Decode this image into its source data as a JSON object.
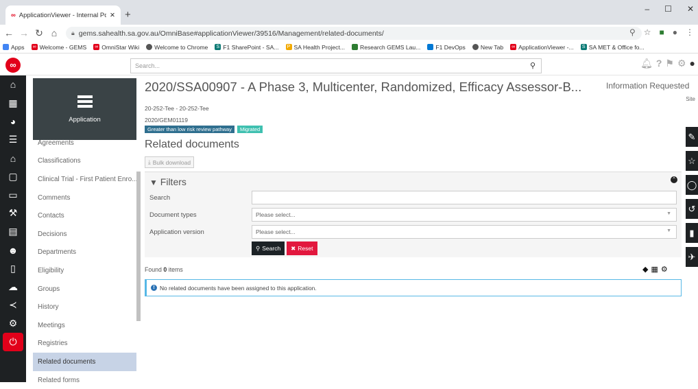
{
  "browser": {
    "tab_title": "ApplicationViewer - Internal Port",
    "url": "gems.sahealth.sa.gov.au/OmniBase#applicationViewer/39516/Management/related-documents/",
    "bookmarks": [
      "Apps",
      "Welcome - GEMS",
      "OmniStar Wiki",
      "Welcome to Chrome",
      "F1 SharePoint - SA...",
      "SA Health Project...",
      "Research GEMS Lau...",
      "F1 DevOps",
      "New Tab",
      "ApplicationViewer -...",
      "SA MET & Office fo..."
    ]
  },
  "topbar": {
    "search_placeholder": "Search..."
  },
  "sidebar": {
    "app_label": "Application",
    "items": [
      "Agreements",
      "Classifications",
      "Clinical Trial - First Patient Enro...",
      "Comments",
      "Contacts",
      "Decisions",
      "Departments",
      "Eligibility",
      "Groups",
      "History",
      "Meetings",
      "Registries",
      "Related documents",
      "Related forms"
    ]
  },
  "app": {
    "title": "2020/SSA00907 - A Phase 3, Multicenter, Randomized, Efficacy Assessor-B...",
    "status": "Information Requested",
    "site": "Site",
    "sub1": "20-252-Tee - 20-252-Tee",
    "sub2": "2020/GEM01119",
    "badges": [
      "Greater than low risk review pathway",
      "Migrated"
    ]
  },
  "section": {
    "title": "Related documents",
    "bulk_label": "Bulk download"
  },
  "filters": {
    "title": "Filters",
    "search_label": "Search",
    "doctype_label": "Document types",
    "appver_label": "Application version",
    "select_placeholder": "Please select...",
    "search_btn": "Search",
    "reset_btn": "Reset"
  },
  "results": {
    "found_prefix": "Found",
    "count": "0",
    "suffix": "items",
    "empty_message": "No related documents have been assigned to this application."
  }
}
